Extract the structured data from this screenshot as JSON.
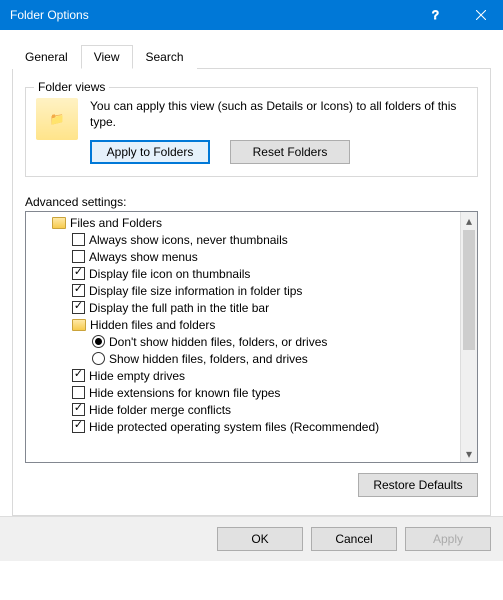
{
  "window": {
    "title": "Folder Options"
  },
  "tabs": {
    "general": "General",
    "view": "View",
    "search": "Search"
  },
  "folderViews": {
    "title": "Folder views",
    "desc": "You can apply this view (such as Details or Icons) to all folders of this type.",
    "applyBtn": "Apply to Folders",
    "resetBtn": "Reset Folders"
  },
  "advancedLabel": "Advanced settings:",
  "tree": {
    "root": "Files and Folders",
    "items": [
      {
        "type": "check",
        "checked": false,
        "label": "Always show icons, never thumbnails"
      },
      {
        "type": "check",
        "checked": false,
        "label": "Always show menus"
      },
      {
        "type": "check",
        "checked": true,
        "label": "Display file icon on thumbnails"
      },
      {
        "type": "check",
        "checked": true,
        "label": "Display file size information in folder tips"
      },
      {
        "type": "check",
        "checked": true,
        "label": "Display the full path in the title bar"
      }
    ],
    "hiddenGroup": {
      "label": "Hidden files and folders",
      "options": [
        {
          "checked": true,
          "label": "Don't show hidden files, folders, or drives"
        },
        {
          "checked": false,
          "label": "Show hidden files, folders, and drives"
        }
      ]
    },
    "items2": [
      {
        "type": "check",
        "checked": true,
        "label": "Hide empty drives"
      },
      {
        "type": "check",
        "checked": false,
        "label": "Hide extensions for known file types"
      },
      {
        "type": "check",
        "checked": true,
        "label": "Hide folder merge conflicts"
      },
      {
        "type": "check",
        "checked": true,
        "label": "Hide protected operating system files (Recommended)"
      }
    ]
  },
  "restoreBtn": "Restore Defaults",
  "buttons": {
    "ok": "OK",
    "cancel": "Cancel",
    "apply": "Apply"
  }
}
